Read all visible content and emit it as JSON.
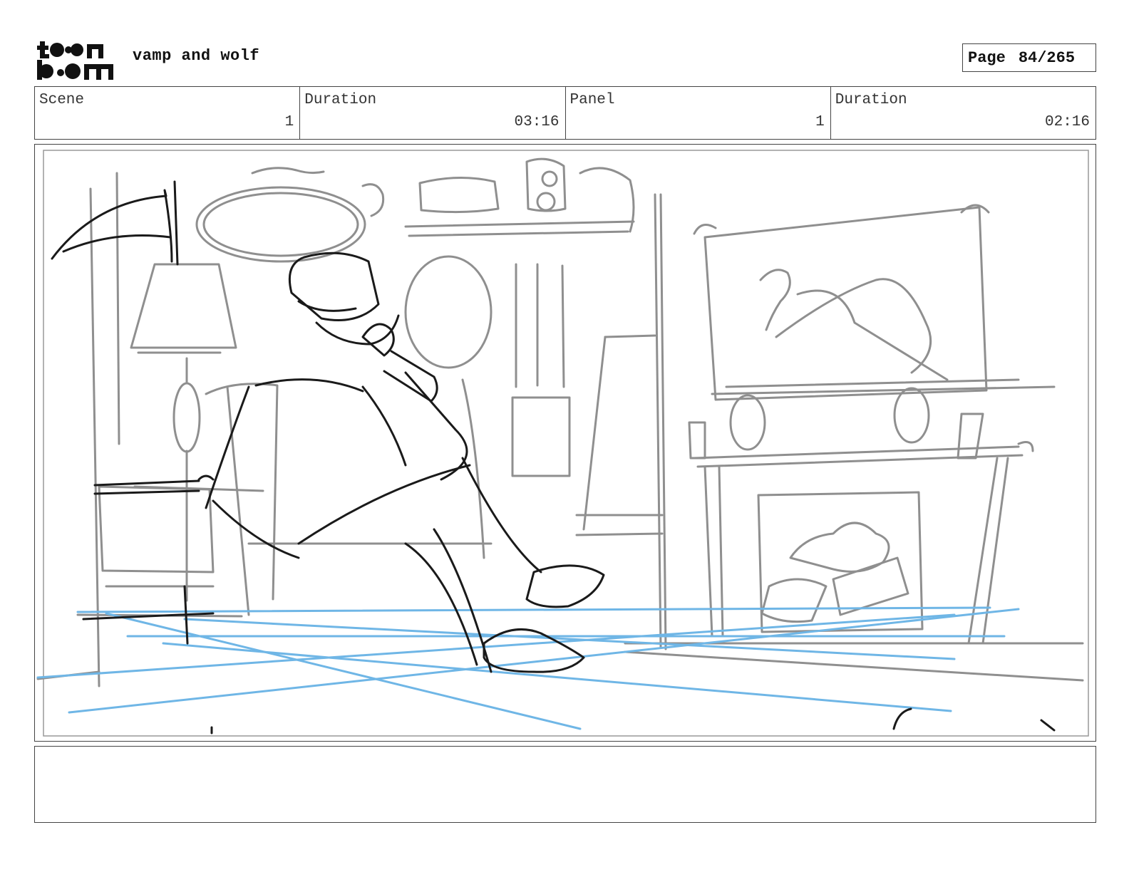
{
  "header": {
    "logo_text": "toon boom",
    "project_title": "vamp and wolf",
    "page_label": "Page",
    "page_number": "84/265"
  },
  "info": {
    "scene_label": "Scene",
    "scene_value": "1",
    "scene_duration_label": "Duration",
    "scene_duration_value": "03:16",
    "panel_label": "Panel",
    "panel_value": "1",
    "panel_duration_label": "Duration",
    "panel_duration_value": "02:16"
  },
  "panel": {
    "sketch_colors": {
      "character": "#1a1a1a",
      "background": "#8f8f8f",
      "perspective": "#6fb6e6"
    }
  },
  "notes": {
    "text": ""
  }
}
